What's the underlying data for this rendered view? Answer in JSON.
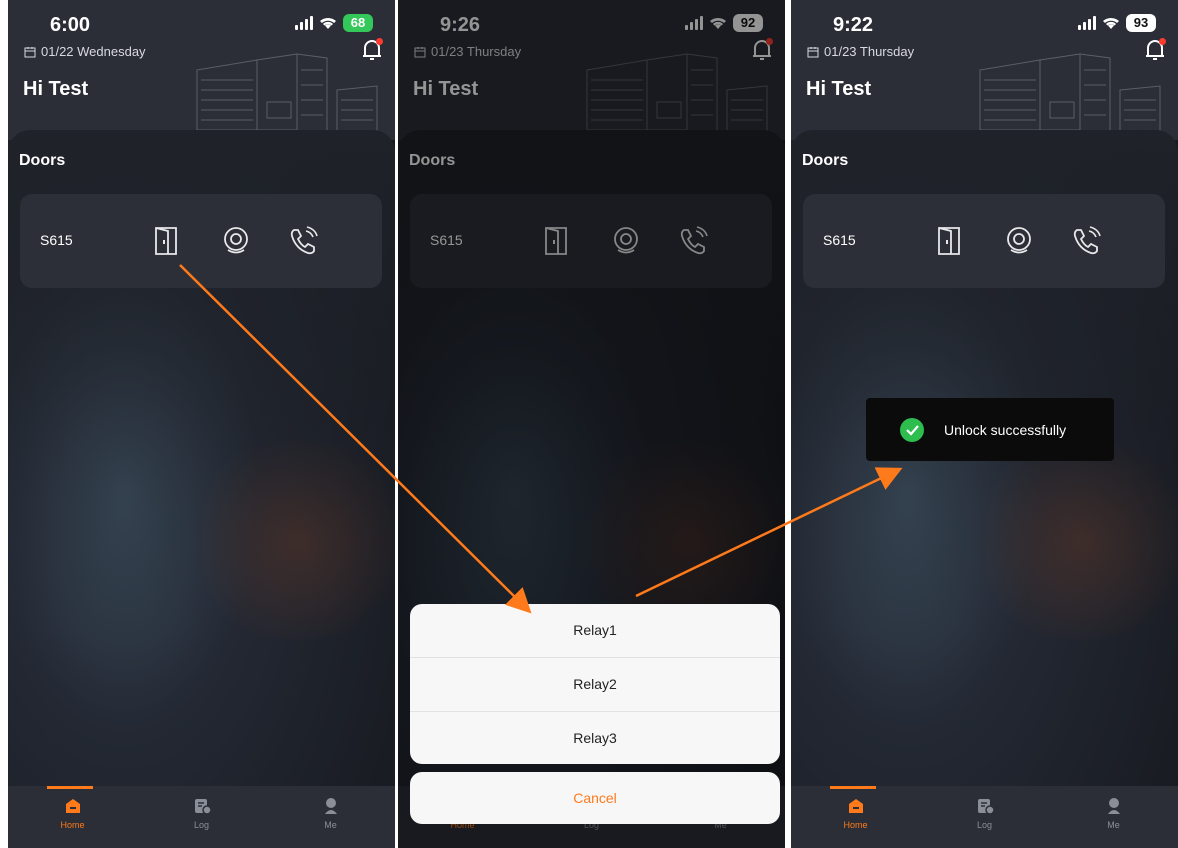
{
  "accent_color": "#ff7a1a",
  "screens": [
    {
      "time": "6:00",
      "battery": "68",
      "date": "01/22 Wednesday",
      "greeting": "Hi Test",
      "section_title": "Doors",
      "door_name": "S615",
      "tabs": [
        "Home",
        "Log",
        "Me"
      ]
    },
    {
      "time": "9:26",
      "battery": "92",
      "date": "01/23 Thursday",
      "greeting": "Hi Test",
      "section_title": "Doors",
      "door_name": "S615",
      "tabs": [
        "Home",
        "Log",
        "Me"
      ],
      "action_sheet": {
        "options": [
          "Relay1",
          "Relay2",
          "Relay3"
        ],
        "cancel": "Cancel"
      }
    },
    {
      "time": "9:22",
      "battery": "93",
      "date": "01/23 Thursday",
      "greeting": "Hi Test",
      "section_title": "Doors",
      "door_name": "S615",
      "tabs": [
        "Home",
        "Log",
        "Me"
      ],
      "toast": "Unlock successfully"
    }
  ]
}
